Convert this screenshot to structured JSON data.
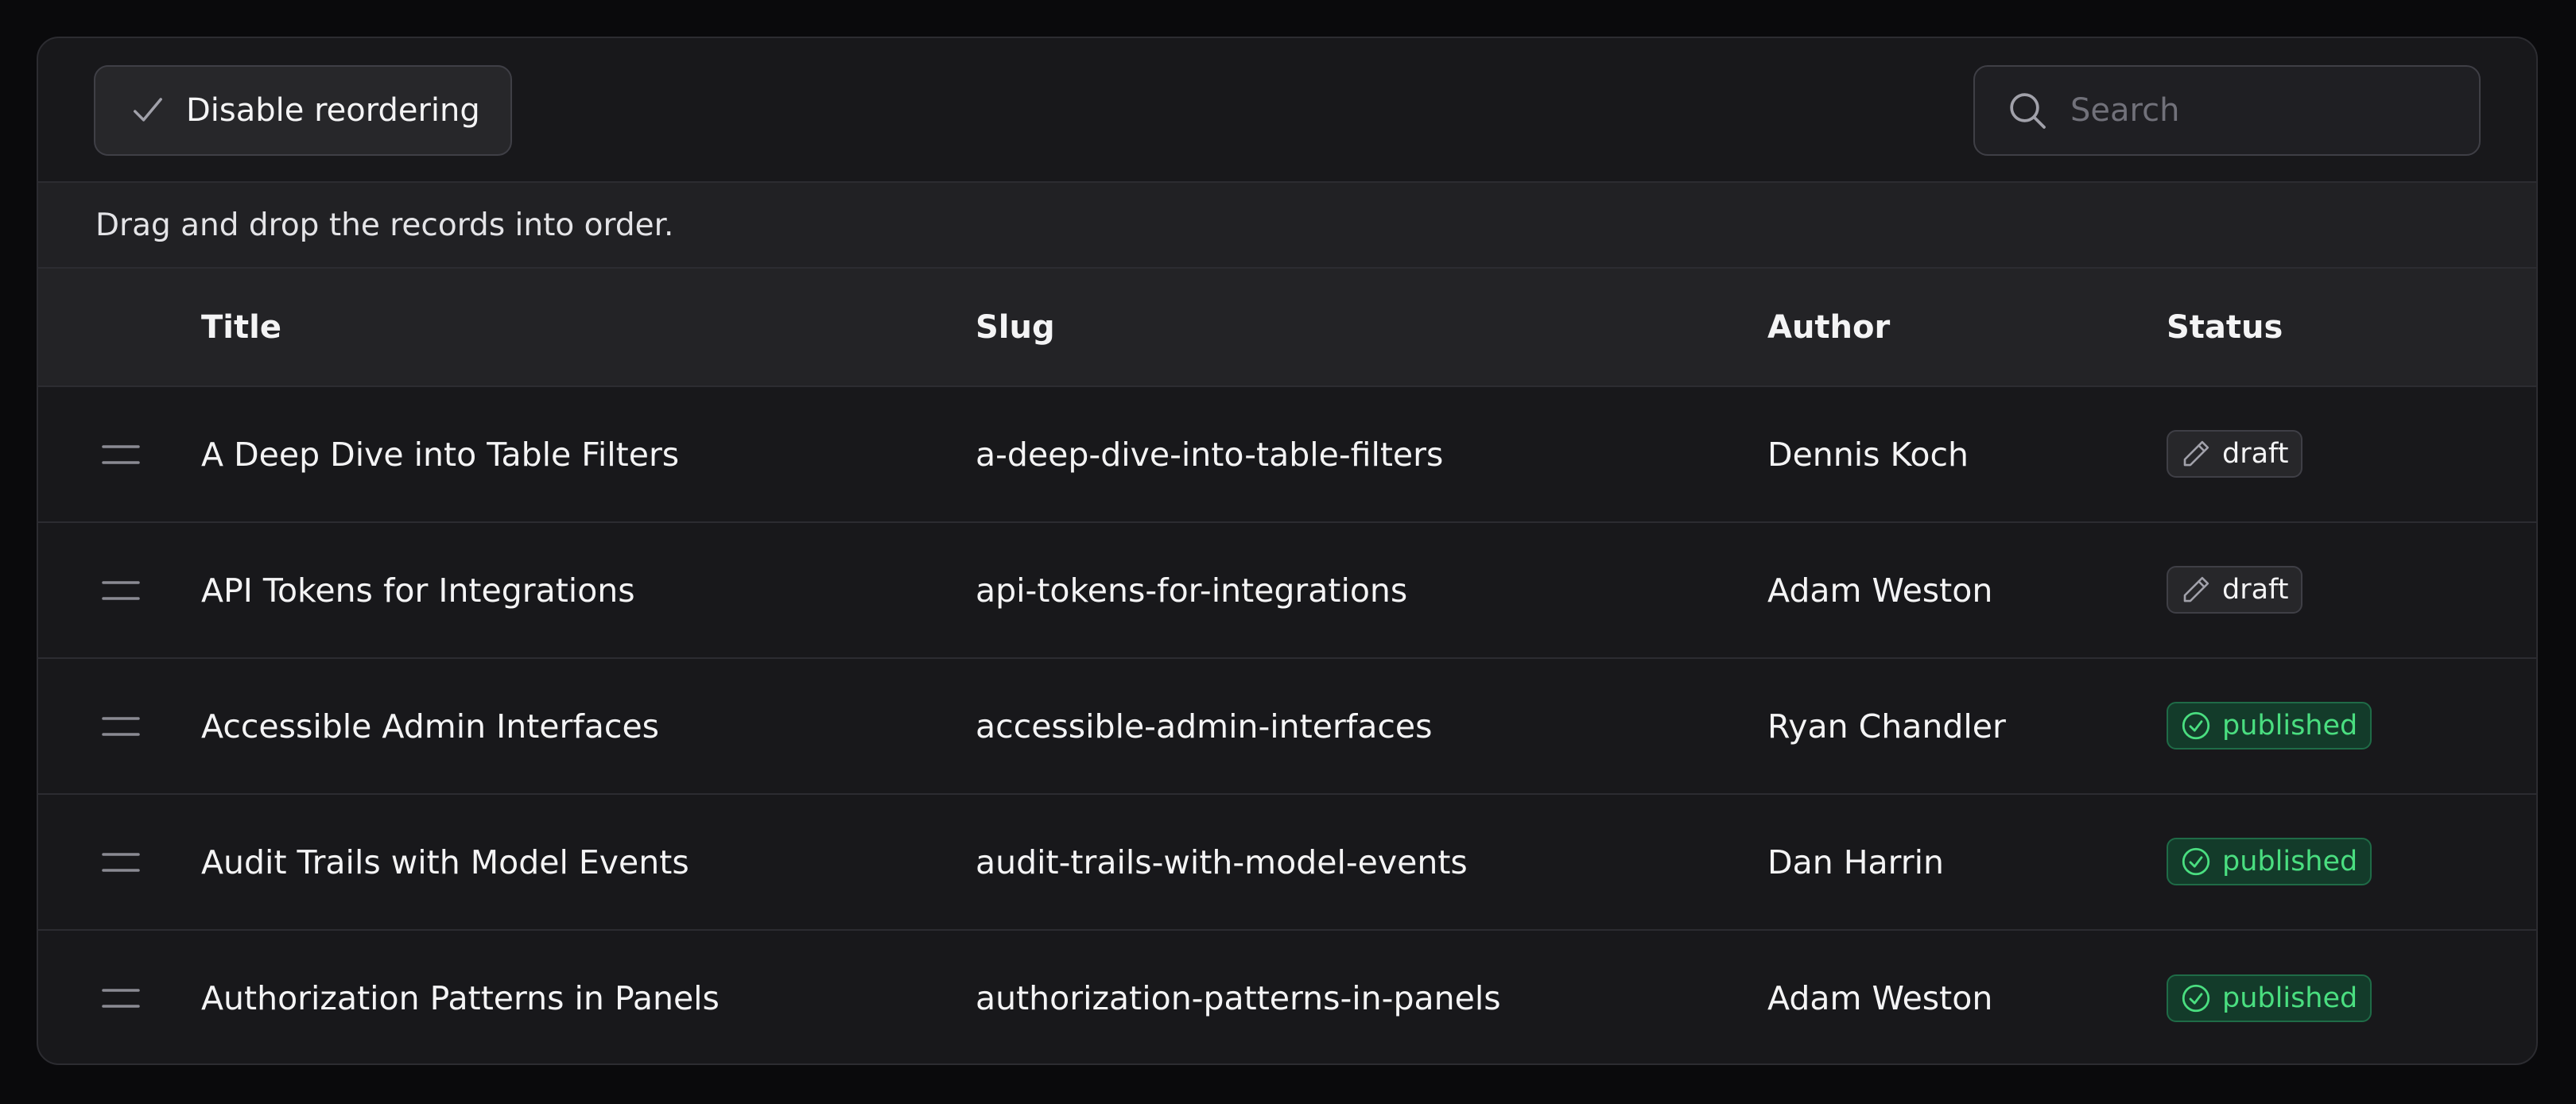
{
  "toolbar": {
    "reorder_label": "Disable reordering",
    "reorder_icon": "check-icon",
    "search_placeholder": "Search",
    "search_icon": "search-icon"
  },
  "hint": "Drag and drop the records into order.",
  "table": {
    "columns": [
      "Title",
      "Slug",
      "Author",
      "Status"
    ],
    "rows": [
      {
        "title": "A Deep Dive into Table Filters",
        "slug": "a-deep-dive-into-table-filters",
        "author": "Dennis Koch",
        "status": "draft"
      },
      {
        "title": "API Tokens for Integrations",
        "slug": "api-tokens-for-integrations",
        "author": "Adam Weston",
        "status": "draft"
      },
      {
        "title": "Accessible Admin Interfaces",
        "slug": "accessible-admin-interfaces",
        "author": "Ryan Chandler",
        "status": "published"
      },
      {
        "title": "Audit Trails with Model Events",
        "slug": "audit-trails-with-model-events",
        "author": "Dan Harrin",
        "status": "published"
      },
      {
        "title": "Authorization Patterns in Panels",
        "slug": "authorization-patterns-in-panels",
        "author": "Adam Weston",
        "status": "published"
      }
    ]
  },
  "status_styles": {
    "draft": {
      "icon": "pencil-icon",
      "color": "#f4f4f5"
    },
    "published": {
      "icon": "check-circle-icon",
      "color": "#4ade80"
    }
  }
}
